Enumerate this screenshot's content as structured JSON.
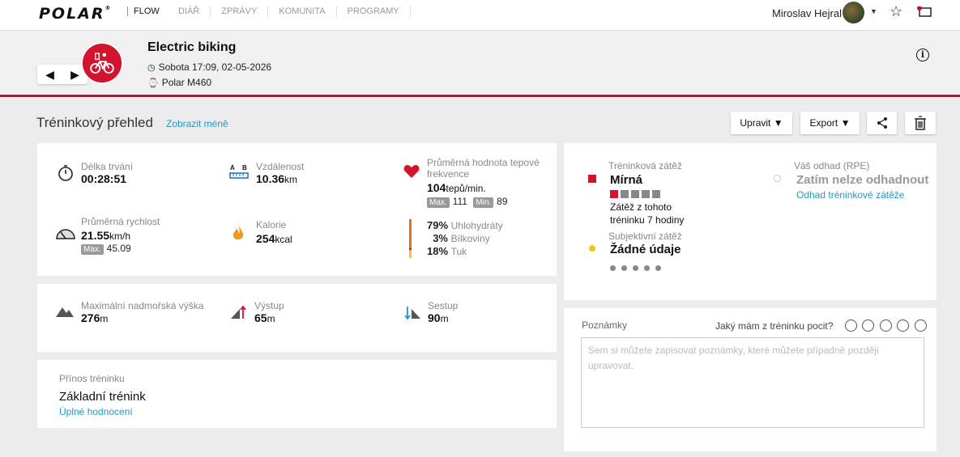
{
  "nav": {
    "brand": "POLAR",
    "product": "FLOW",
    "items": [
      "DIÁŘ",
      "ZPRÁVY",
      "KOMUNITA",
      "PROGRAMY"
    ],
    "user_name": "Miroslav Hejral"
  },
  "session": {
    "sport": "Electric biking",
    "datetime": "Sobota 17:09, 02-05-2026",
    "device": "Polar M460"
  },
  "overview": {
    "title": "Tréninkový přehled",
    "toggle": "Zobrazit méně",
    "edit_btn": "Upravit ▼",
    "export_btn": "Export ▼"
  },
  "stats": {
    "duration_label": "Délka trvání",
    "duration_value": "00:28:51",
    "distance_label": "Vzdálenost",
    "distance_value": "10.36",
    "distance_unit": "km",
    "hr_label": "Průměrná hodnota tepové frekvence",
    "hr_value": "104",
    "hr_unit": "tepů/min.",
    "hr_max_label": "Max.",
    "hr_max": "111",
    "hr_min_label": "Min.",
    "hr_min": "89",
    "speed_label": "Průměrná rychlost",
    "speed_value": "21.55",
    "speed_unit": "km/h",
    "speed_max_label": "Max.",
    "speed_max": "45.09",
    "cal_label": "Kalorie",
    "cal_value": "254",
    "cal_unit": "kcal",
    "carb_pct": "79%",
    "carb_label": "Uhlohydráty",
    "prot_pct": "3%",
    "prot_label": "Bílkoviny",
    "fat_pct": "18%",
    "fat_label": "Tuk"
  },
  "altitude": {
    "max_label": "Maximální nadmořská výška",
    "max_value": "276",
    "ascent_label": "Výstup",
    "ascent_value": "65",
    "descent_label": "Sestup",
    "descent_value": "90",
    "unit": "m"
  },
  "benefit": {
    "label": "Přínos tréninku",
    "value": "Základní trénink",
    "link": "Úplné hodnocení"
  },
  "load": {
    "label": "Tréninková zátěž",
    "value": "Mírná",
    "level": 1,
    "level_max": 5,
    "desc1": "Zátěž z tohoto",
    "desc2": "tréninku 7 hodiny",
    "subj_label": "Subjektivní zátěž",
    "subj_value": "Žádné údaje",
    "rpe_label": "Váš odhad (RPE)",
    "rpe_value": "Zatím nelze odhadnout",
    "rpe_link": "Odhad tréninkové zátěže",
    "accent": "#d4142e"
  },
  "notes": {
    "label": "Poznámky",
    "feeling": "Jaký mám z tréninku pocit?",
    "placeholder": "Sem si můžete zapisovat poznámky, které můžete případně později upravovat."
  }
}
